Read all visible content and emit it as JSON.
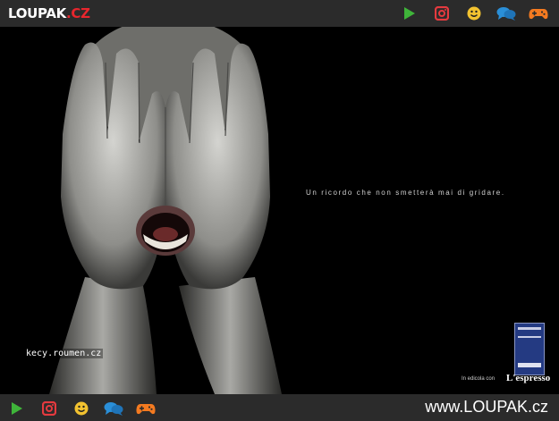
{
  "header": {
    "logo_main": "LOUPAK",
    "logo_tld": ".CZ",
    "icons": [
      "play-icon",
      "instagram-icon",
      "smiley-icon",
      "chat-icon",
      "gamepad-icon"
    ]
  },
  "photo": {
    "tagline": "Un ricordo che non smetterà mai di gridare.",
    "watermark": "kecy.roumen.cz",
    "edicola_text": "In edicola con",
    "brand": "L'espresso"
  },
  "footer": {
    "site_url": "www.LOUPAK.cz",
    "icons": [
      "play-icon",
      "instagram-icon",
      "smiley-icon",
      "chat-icon",
      "gamepad-icon"
    ]
  },
  "colors": {
    "bar": "#2b2b2b",
    "play": "#3fb53a",
    "instagram": "#e53a3f",
    "smiley": "#f2c230",
    "chat": "#2a8fd8",
    "gamepad": "#f47a20",
    "logo_accent": "#e8262d"
  }
}
